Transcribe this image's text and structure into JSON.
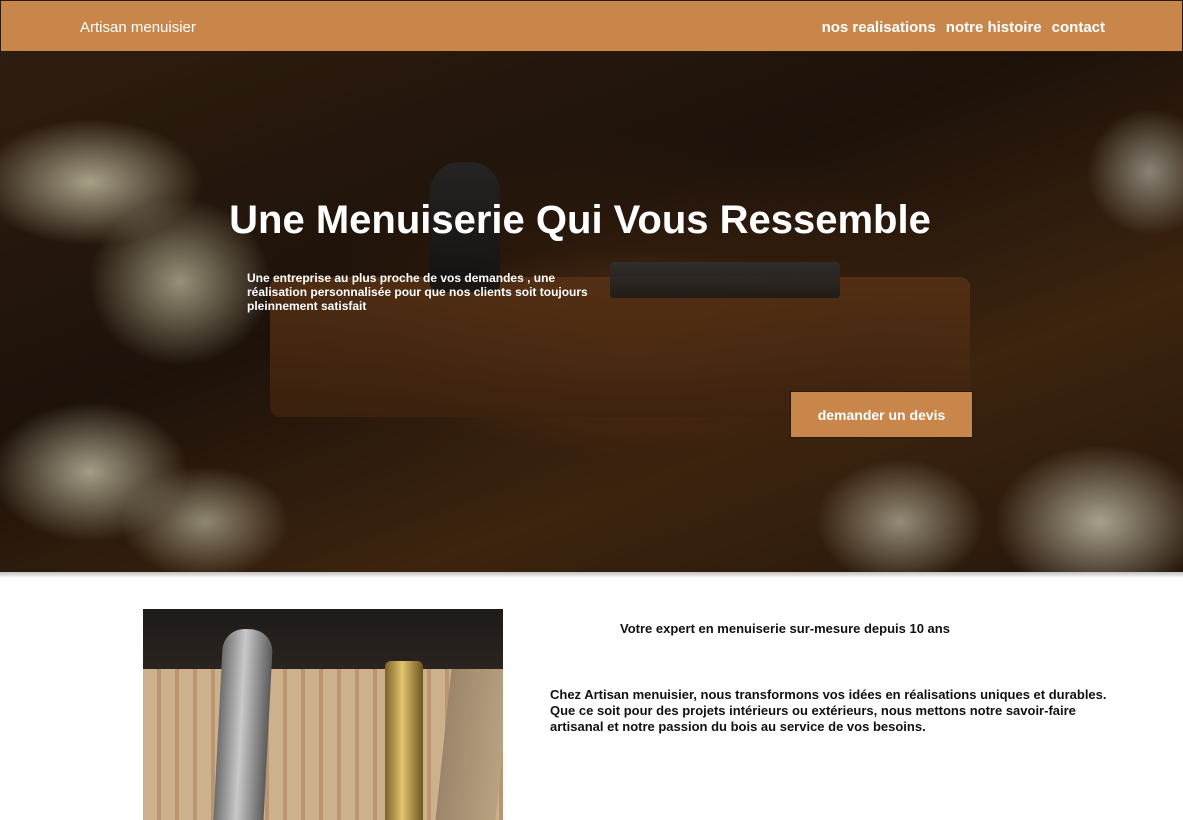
{
  "navbar": {
    "brand": "Artisan menuisier",
    "links": [
      {
        "label": "nos realisations"
      },
      {
        "label": "notre histoire"
      },
      {
        "label": "contact"
      }
    ]
  },
  "hero": {
    "title": "Une Menuiserie Qui Vous Ressemble",
    "text": "Une entreprise au plus proche de vos demandes , une réalisation personnalisée pour que nos clients soit toujours pleinnement satisfait",
    "cta_label": "demander un devis"
  },
  "about": {
    "heading": "Votre expert en menuiserie sur-mesure depuis 10 ans",
    "text": "Chez Artisan menuisier, nous transformons vos idées en réalisations uniques et durables. Que ce soit pour des projets intérieurs ou extérieurs, nous mettons notre savoir-faire artisanal et notre passion du bois au service de vos besoins."
  },
  "colors": {
    "accent": "#c8864a",
    "text_dark": "#111111",
    "text_light": "#ffffff"
  }
}
